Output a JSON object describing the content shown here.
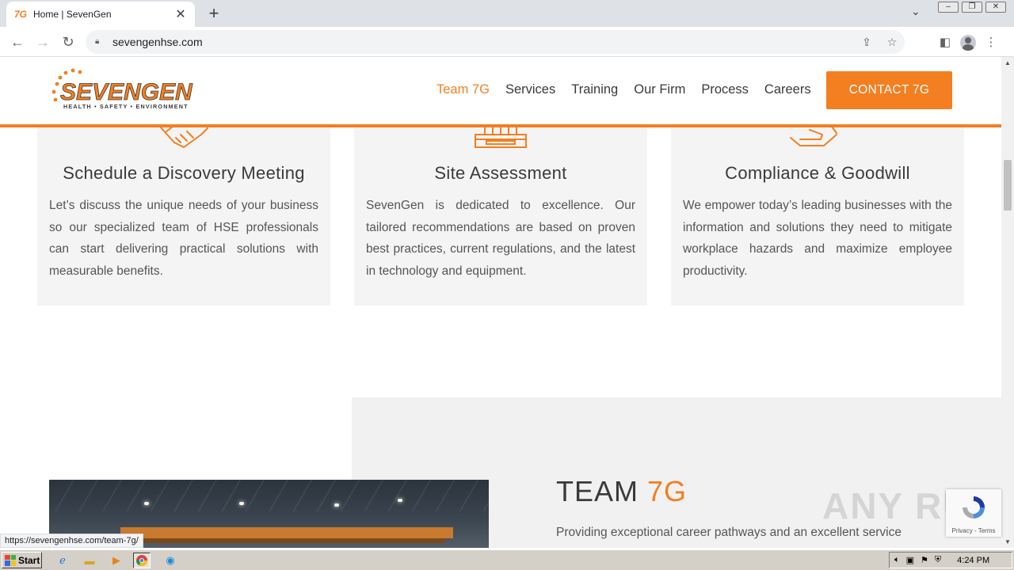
{
  "browser": {
    "tab_title": "Home | SevenGen",
    "tab_favicon": "7G",
    "tab_close": "✕",
    "new_tab": "+",
    "url": "sevengenhse.com"
  },
  "header": {
    "logo_text": "SEVENGEN",
    "logo_tagline": "HEALTH • SAFETY • ENVIRONMENT",
    "nav": [
      "Team 7G",
      "Services",
      "Training",
      "Our Firm",
      "Process",
      "Careers"
    ],
    "contact_label": "CONTACT 7G",
    "accent_color": "#f37f20"
  },
  "cards": [
    {
      "icon": "handshake-icon",
      "title": "Schedule a Discovery Meeting",
      "text": "Let’s discuss the unique needs of your business so our specialized team of HSE professionals can start delivering practical solutions with measurable benefits."
    },
    {
      "icon": "building-icon",
      "title": "Site Assessment",
      "text": "SevenGen is dedicated to excellence. Our tailored recommendations are based on proven best practices, current regulations, and the latest in technology and equipment."
    },
    {
      "icon": "hand-heart-icon",
      "title": "Compliance & Goodwill",
      "text": "We empower today’s leading businesses with the information and solutions they need to mitigate workplace hazards and maximize employee productivity."
    }
  ],
  "team": {
    "heading_part1": "TEAM ",
    "heading_part2": "7G",
    "text": "Providing exceptional career pathways and an excellent service"
  },
  "status_url": "https://sevengenhse.com/team-7g/",
  "recaptcha_terms": "Privacy - Terms",
  "watermark": "ANY RUN",
  "taskbar": {
    "start_label": "Start",
    "clock": "4:24 PM"
  }
}
